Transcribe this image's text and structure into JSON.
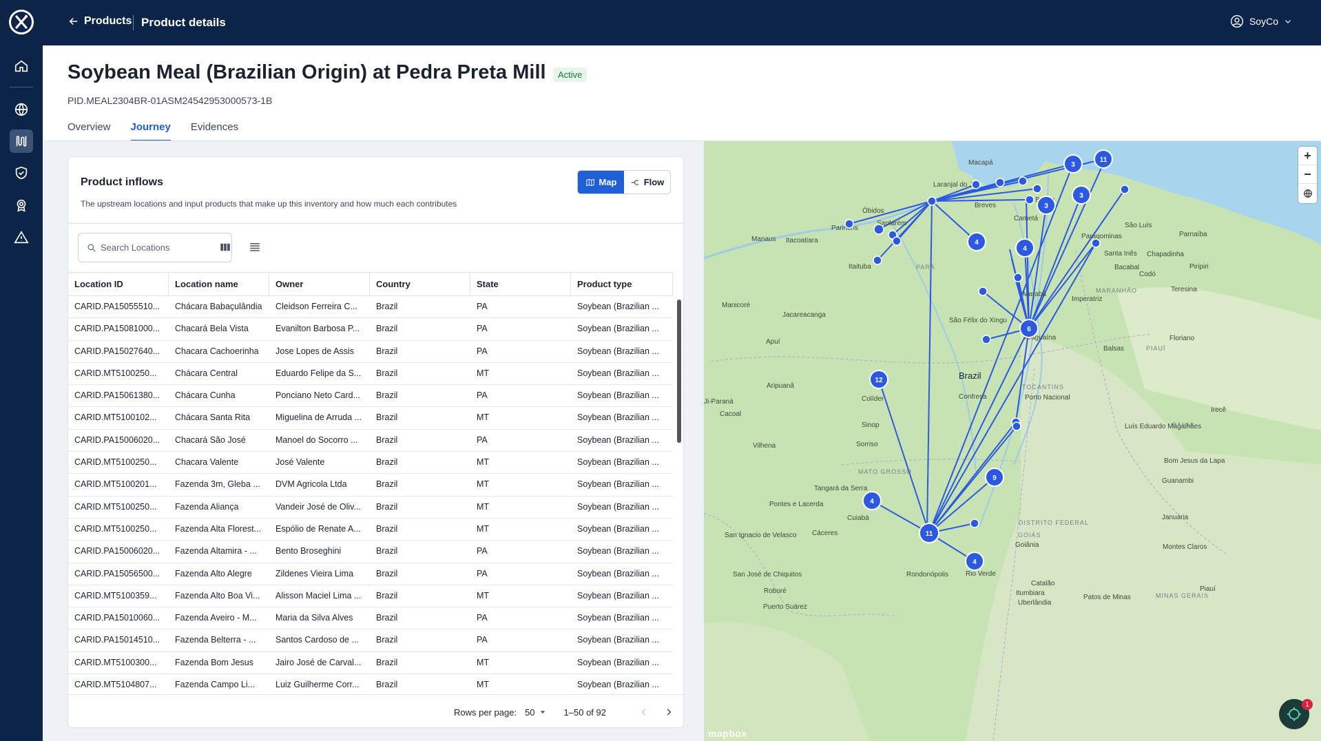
{
  "nav": {
    "back_label": "Products",
    "current_label": "Product details",
    "user_name": "SoyCo"
  },
  "header": {
    "title": "Soybean Meal (Brazilian Origin) at Pedra Preta Mill",
    "status": "Active",
    "pid": "PID.MEAL2304BR-01ASM24542953000573-1B"
  },
  "tabs": [
    {
      "label": "Overview",
      "active": false
    },
    {
      "label": "Journey",
      "active": true
    },
    {
      "label": "Evidences",
      "active": false
    }
  ],
  "inflows": {
    "title": "Product inflows",
    "description": "The upstream locations and input products that make up this inventory and how much each contributes",
    "toggle": {
      "map_label": "Map",
      "flow_label": "Flow",
      "selected": "Map"
    },
    "search_placeholder": "Search Locations",
    "columns": [
      "Location ID",
      "Location name",
      "Owner",
      "Country",
      "State",
      "Product type"
    ],
    "rows": [
      [
        "CARID.PA15055510...",
        "Chácara Babaçulândia",
        "Cleidson Ferreira C...",
        "Brazil",
        "PA",
        "Soybean (Brazilian ..."
      ],
      [
        "CARID.PA15081000...",
        "Chacará Bela Vista",
        "Evanilton Barbosa P...",
        "Brazil",
        "PA",
        "Soybean (Brazilian ..."
      ],
      [
        "CARID.PA15027640...",
        "Chacara Cachoerinha",
        "Jose Lopes de Assis",
        "Brazil",
        "PA",
        "Soybean (Brazilian ..."
      ],
      [
        "CARID.MT5100250...",
        "Chácara Central",
        "Eduardo Felipe da S...",
        "Brazil",
        "MT",
        "Soybean (Brazilian ..."
      ],
      [
        "CARID.PA15061380...",
        "Chácara Cunha",
        "Ponciano Neto Card...",
        "Brazil",
        "PA",
        "Soybean (Brazilian ..."
      ],
      [
        "CARID.MT5100102...",
        "Chácara Santa Rita",
        "Miguelina de Arruda ...",
        "Brazil",
        "MT",
        "Soybean (Brazilian ..."
      ],
      [
        "CARID.PA15006020...",
        "Chacará São José",
        "Manoel do Socorro ...",
        "Brazil",
        "PA",
        "Soybean (Brazilian ..."
      ],
      [
        "CARID.MT5100250...",
        "Chacara Valente",
        "José Valente",
        "Brazil",
        "MT",
        "Soybean (Brazilian ..."
      ],
      [
        "CARID.MT5100201...",
        "Fazenda 3m, Gleba ...",
        "DVM Agricola Ltda",
        "Brazil",
        "MT",
        "Soybean (Brazilian ..."
      ],
      [
        "CARID.MT5100250...",
        "Fazenda Aliança",
        "Vandeir José de Oliv...",
        "Brazil",
        "MT",
        "Soybean (Brazilian ..."
      ],
      [
        "CARID.MT5100250...",
        "Fazenda Alta Florest...",
        "Espólio de Renate A...",
        "Brazil",
        "MT",
        "Soybean (Brazilian ..."
      ],
      [
        "CARID.PA15006020...",
        "Fazenda Altamira - ...",
        "Bento Broseghini",
        "Brazil",
        "PA",
        "Soybean (Brazilian ..."
      ],
      [
        "CARID.PA15056500...",
        "Fazenda Alto Alegre",
        "Zildenes Vieira Lima",
        "Brazil",
        "PA",
        "Soybean (Brazilian ..."
      ],
      [
        "CARID.MT5100359...",
        "Fazenda Alto Boa Vi...",
        "Alisson Maciel Lima ...",
        "Brazil",
        "MT",
        "Soybean (Brazilian ..."
      ],
      [
        "CARID.PA15010060...",
        "Fazenda Aveiro - M...",
        "Maria da Silva Alves",
        "Brazil",
        "PA",
        "Soybean (Brazilian ..."
      ],
      [
        "CARID.PA15014510...",
        "Fazenda Belterra - ...",
        "Santos Cardoso de ...",
        "Brazil",
        "PA",
        "Soybean (Brazilian ..."
      ],
      [
        "CARID.MT5100300...",
        "Fazenda Bom Jesus",
        "Jairo José de Carval...",
        "Brazil",
        "MT",
        "Soybean (Brazilian ..."
      ],
      [
        "CARID.MT5104807...",
        "Fazenda Campo Li...",
        "Luiz Guilherme Corr...",
        "Brazil",
        "MT",
        "Soybean (Brazilian ..."
      ]
    ],
    "pagination": {
      "rows_per_page_label": "Rows per page:",
      "rows_per_page": "50",
      "range": "1–50 of 92"
    }
  },
  "map": {
    "attribution": "mapbox",
    "help_badge_count": "1",
    "zoom_in": "+",
    "zoom_out": "−",
    "labels": [
      "Macapá",
      "Laranjal do Jari",
      "Óbidos",
      "Parintins",
      "Santarém",
      "Breves",
      "Belém",
      "Cametá",
      "Manaus",
      "Itacoatiara",
      "Itaituba",
      "PARÁ",
      "São Luís",
      "Paragominas",
      "Santa Inês",
      "Chapadinha",
      "Bacabal",
      "Codó",
      "Parnaíba",
      "Piripiri",
      "Marabá",
      "MARANHÃO",
      "Imperatriz",
      "Teresina",
      "Manicoré",
      "Jacareacanga",
      "São Félix do Xingu",
      "Araguaína",
      "Floriano",
      "Apuí",
      "PIAUÍ",
      "Balsas",
      "Brazil",
      "Aripuanã",
      "TOCANTINS",
      "Porto Nacional",
      "Colíder",
      "Confresa",
      "Ji-Paraná",
      "Cacoal",
      "Sinop",
      "Luís Eduardo Magalhães",
      "BAHIA",
      "Irecê",
      "Vilhena",
      "Sorriso",
      "Bom Jesus da Lapa",
      "MATO GROSSO",
      "Tangará da Serra",
      "Guanambi",
      "Pontes e Lacerda",
      "Cuiabá",
      "DISTRITO FEDERAL",
      "Januária",
      "Cáceres",
      "San Ignacio de Velasco",
      "GOIÁS",
      "Goiânia",
      "Montes Claros",
      "San José de Chiquitos",
      "Rondonópolis",
      "Rio Verde",
      "Catalão",
      "Roboré",
      "Itumbiara",
      "Puerto Suárez",
      "Uberlândia",
      "Patos de Minas",
      "MINAS GERAIS",
      "Piauí"
    ],
    "clusters": [
      "3",
      "11",
      "3",
      "4",
      "3",
      "4",
      "6",
      "12",
      "9",
      "4",
      "11",
      "4"
    ]
  }
}
